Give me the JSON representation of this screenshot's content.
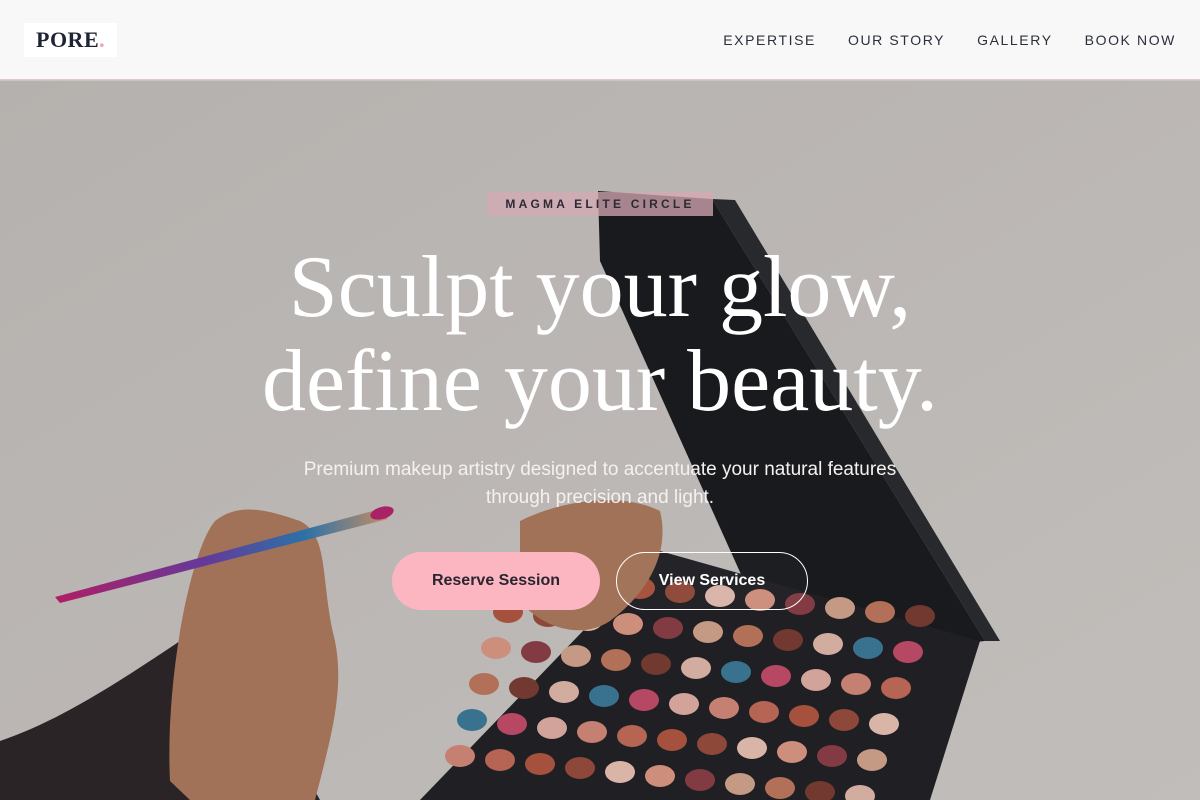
{
  "header": {
    "logo_text": "PORE",
    "logo_dot": ".",
    "nav": [
      {
        "label": "EXPERTISE"
      },
      {
        "label": "OUR STORY"
      },
      {
        "label": "GALLERY"
      },
      {
        "label": "BOOK NOW"
      }
    ]
  },
  "hero": {
    "badge": "MAGMA ELITE CIRCLE",
    "headline_line1": "Sculpt your glow,",
    "headline_line2": "define your beauty.",
    "subtext_line1": "Premium makeup artistry designed to accentuate your natural features",
    "subtext_line2": "through precision and light.",
    "primary_button": "Reserve Session",
    "secondary_button": "View Services",
    "background_image": "makeup-palette-photo"
  },
  "colors": {
    "accent_pink": "#fbb6c2",
    "logo_dark": "#1f2433",
    "header_bg": "#f8f8f8"
  }
}
